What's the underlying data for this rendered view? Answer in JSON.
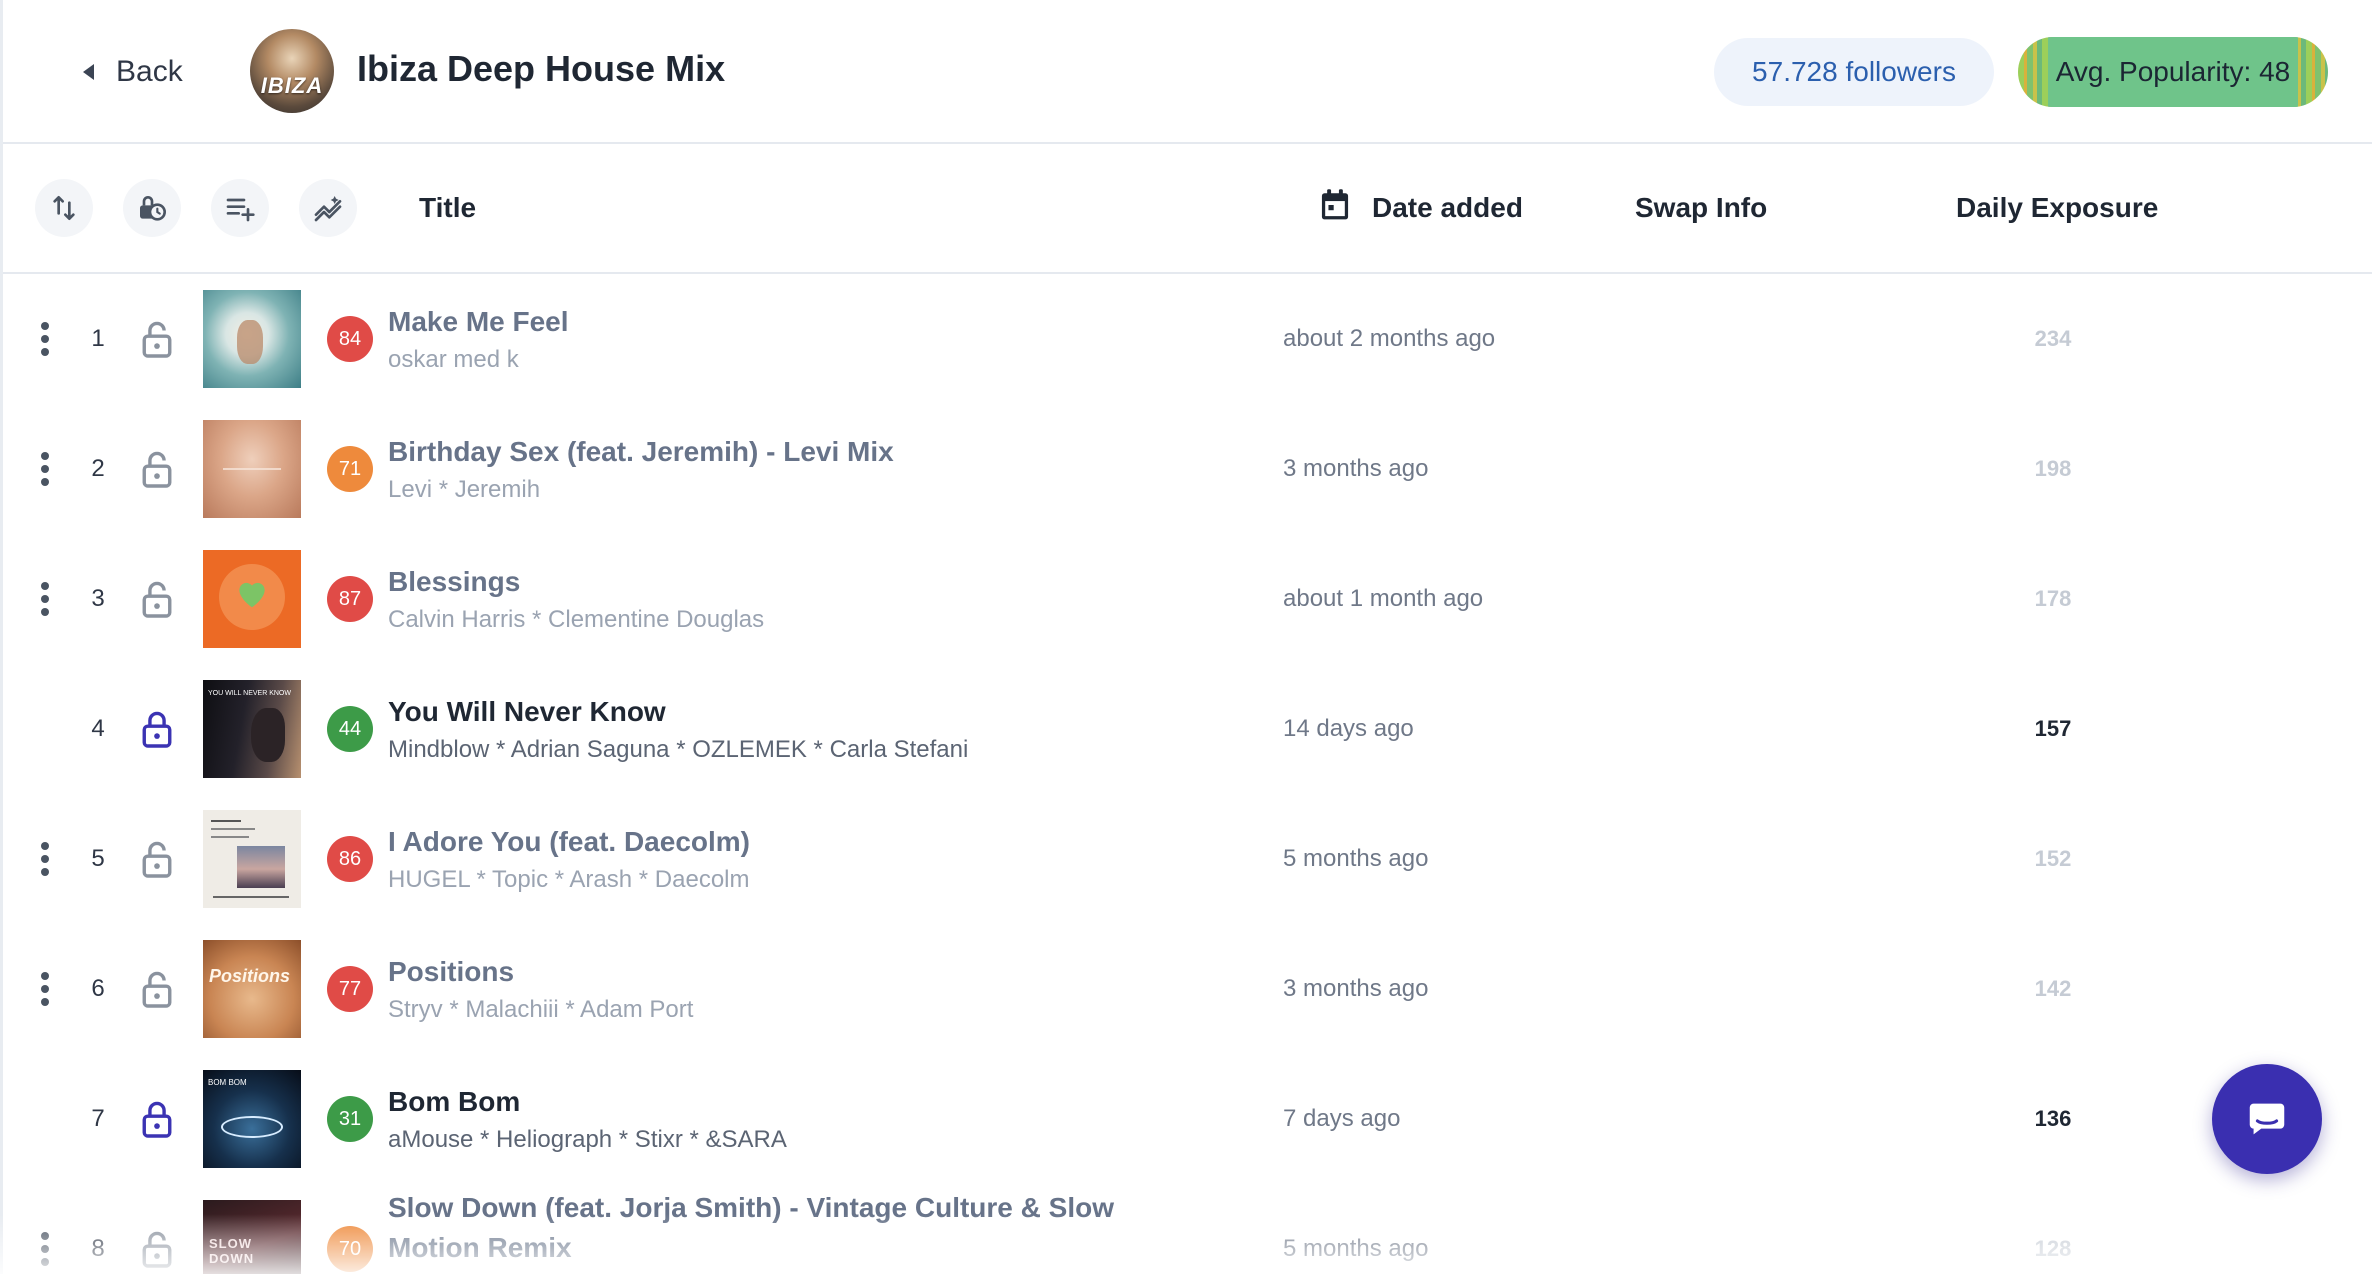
{
  "header": {
    "back_label": "Back",
    "playlist_cover_text": "IBIZA",
    "playlist_title": "Ibiza Deep House Mix",
    "followers_label": "57.728 followers",
    "popularity_label": "Avg. Popularity: 48"
  },
  "toolbar": {
    "icons": [
      "sort-icon",
      "lock-clock-icon",
      "playlist-add-icon",
      "trend-icon"
    ],
    "columns": {
      "title": "Title",
      "date_added": "Date added",
      "swap_info": "Swap Info",
      "daily_exposure": "Daily Exposure"
    }
  },
  "tracks": [
    {
      "index": "1",
      "popularity": "84",
      "popularity_color": "#e04b47",
      "title": "Make Me Feel",
      "artists": "oskar med k",
      "date_added": "about 2 months ago",
      "daily_exposure": "234",
      "locked": false
    },
    {
      "index": "2",
      "popularity": "71",
      "popularity_color": "#ee8a3c",
      "title": "Birthday Sex (feat. Jeremih) - Levi Mix",
      "artists": "Levi * Jeremih",
      "date_added": "3 months ago",
      "daily_exposure": "198",
      "locked": false
    },
    {
      "index": "3",
      "popularity": "87",
      "popularity_color": "#e04b47",
      "title": "Blessings",
      "artists": "Calvin Harris * Clementine Douglas",
      "date_added": "about 1 month ago",
      "daily_exposure": "178",
      "locked": false
    },
    {
      "index": "4",
      "popularity": "44",
      "popularity_color": "#3d9b48",
      "title": "You Will Never Know",
      "artists": "Mindblow * Adrian Saguna * OZLEMEK * Carla Stefani",
      "date_added": "14 days ago",
      "daily_exposure": "157",
      "locked": true
    },
    {
      "index": "5",
      "popularity": "86",
      "popularity_color": "#e04b47",
      "title": "I Adore You (feat. Daecolm)",
      "artists": "HUGEL * Topic * Arash * Daecolm",
      "date_added": "5 months ago",
      "daily_exposure": "152",
      "locked": false
    },
    {
      "index": "6",
      "popularity": "77",
      "popularity_color": "#e04b47",
      "title": "Positions",
      "artists": "Stryv * Malachiii * Adam Port",
      "date_added": "3 months ago",
      "daily_exposure": "142",
      "locked": false
    },
    {
      "index": "7",
      "popularity": "31",
      "popularity_color": "#3d9b48",
      "title": "Bom Bom",
      "artists": "aMouse * Heliograph * Stixr * &SARA",
      "date_added": "7 days ago",
      "daily_exposure": "136",
      "locked": true
    },
    {
      "index": "8",
      "popularity": "70",
      "popularity_color": "#ee8a3c",
      "title": "Slow Down (feat. Jorja Smith) - Vintage Culture & Slow Motion Remix",
      "artists": "",
      "date_added": "5 months ago",
      "daily_exposure": "128",
      "locked": false
    }
  ],
  "artwork_text": {
    "track4": "YOU WILL NEVER KNOW",
    "track6": "Positions",
    "track7": "BOM BOM",
    "track8": "SLOW DOWN"
  },
  "colors": {
    "accent": "#3a2fb0",
    "followers_text": "#2b5fae",
    "locked_icon": "#3b33b3"
  }
}
